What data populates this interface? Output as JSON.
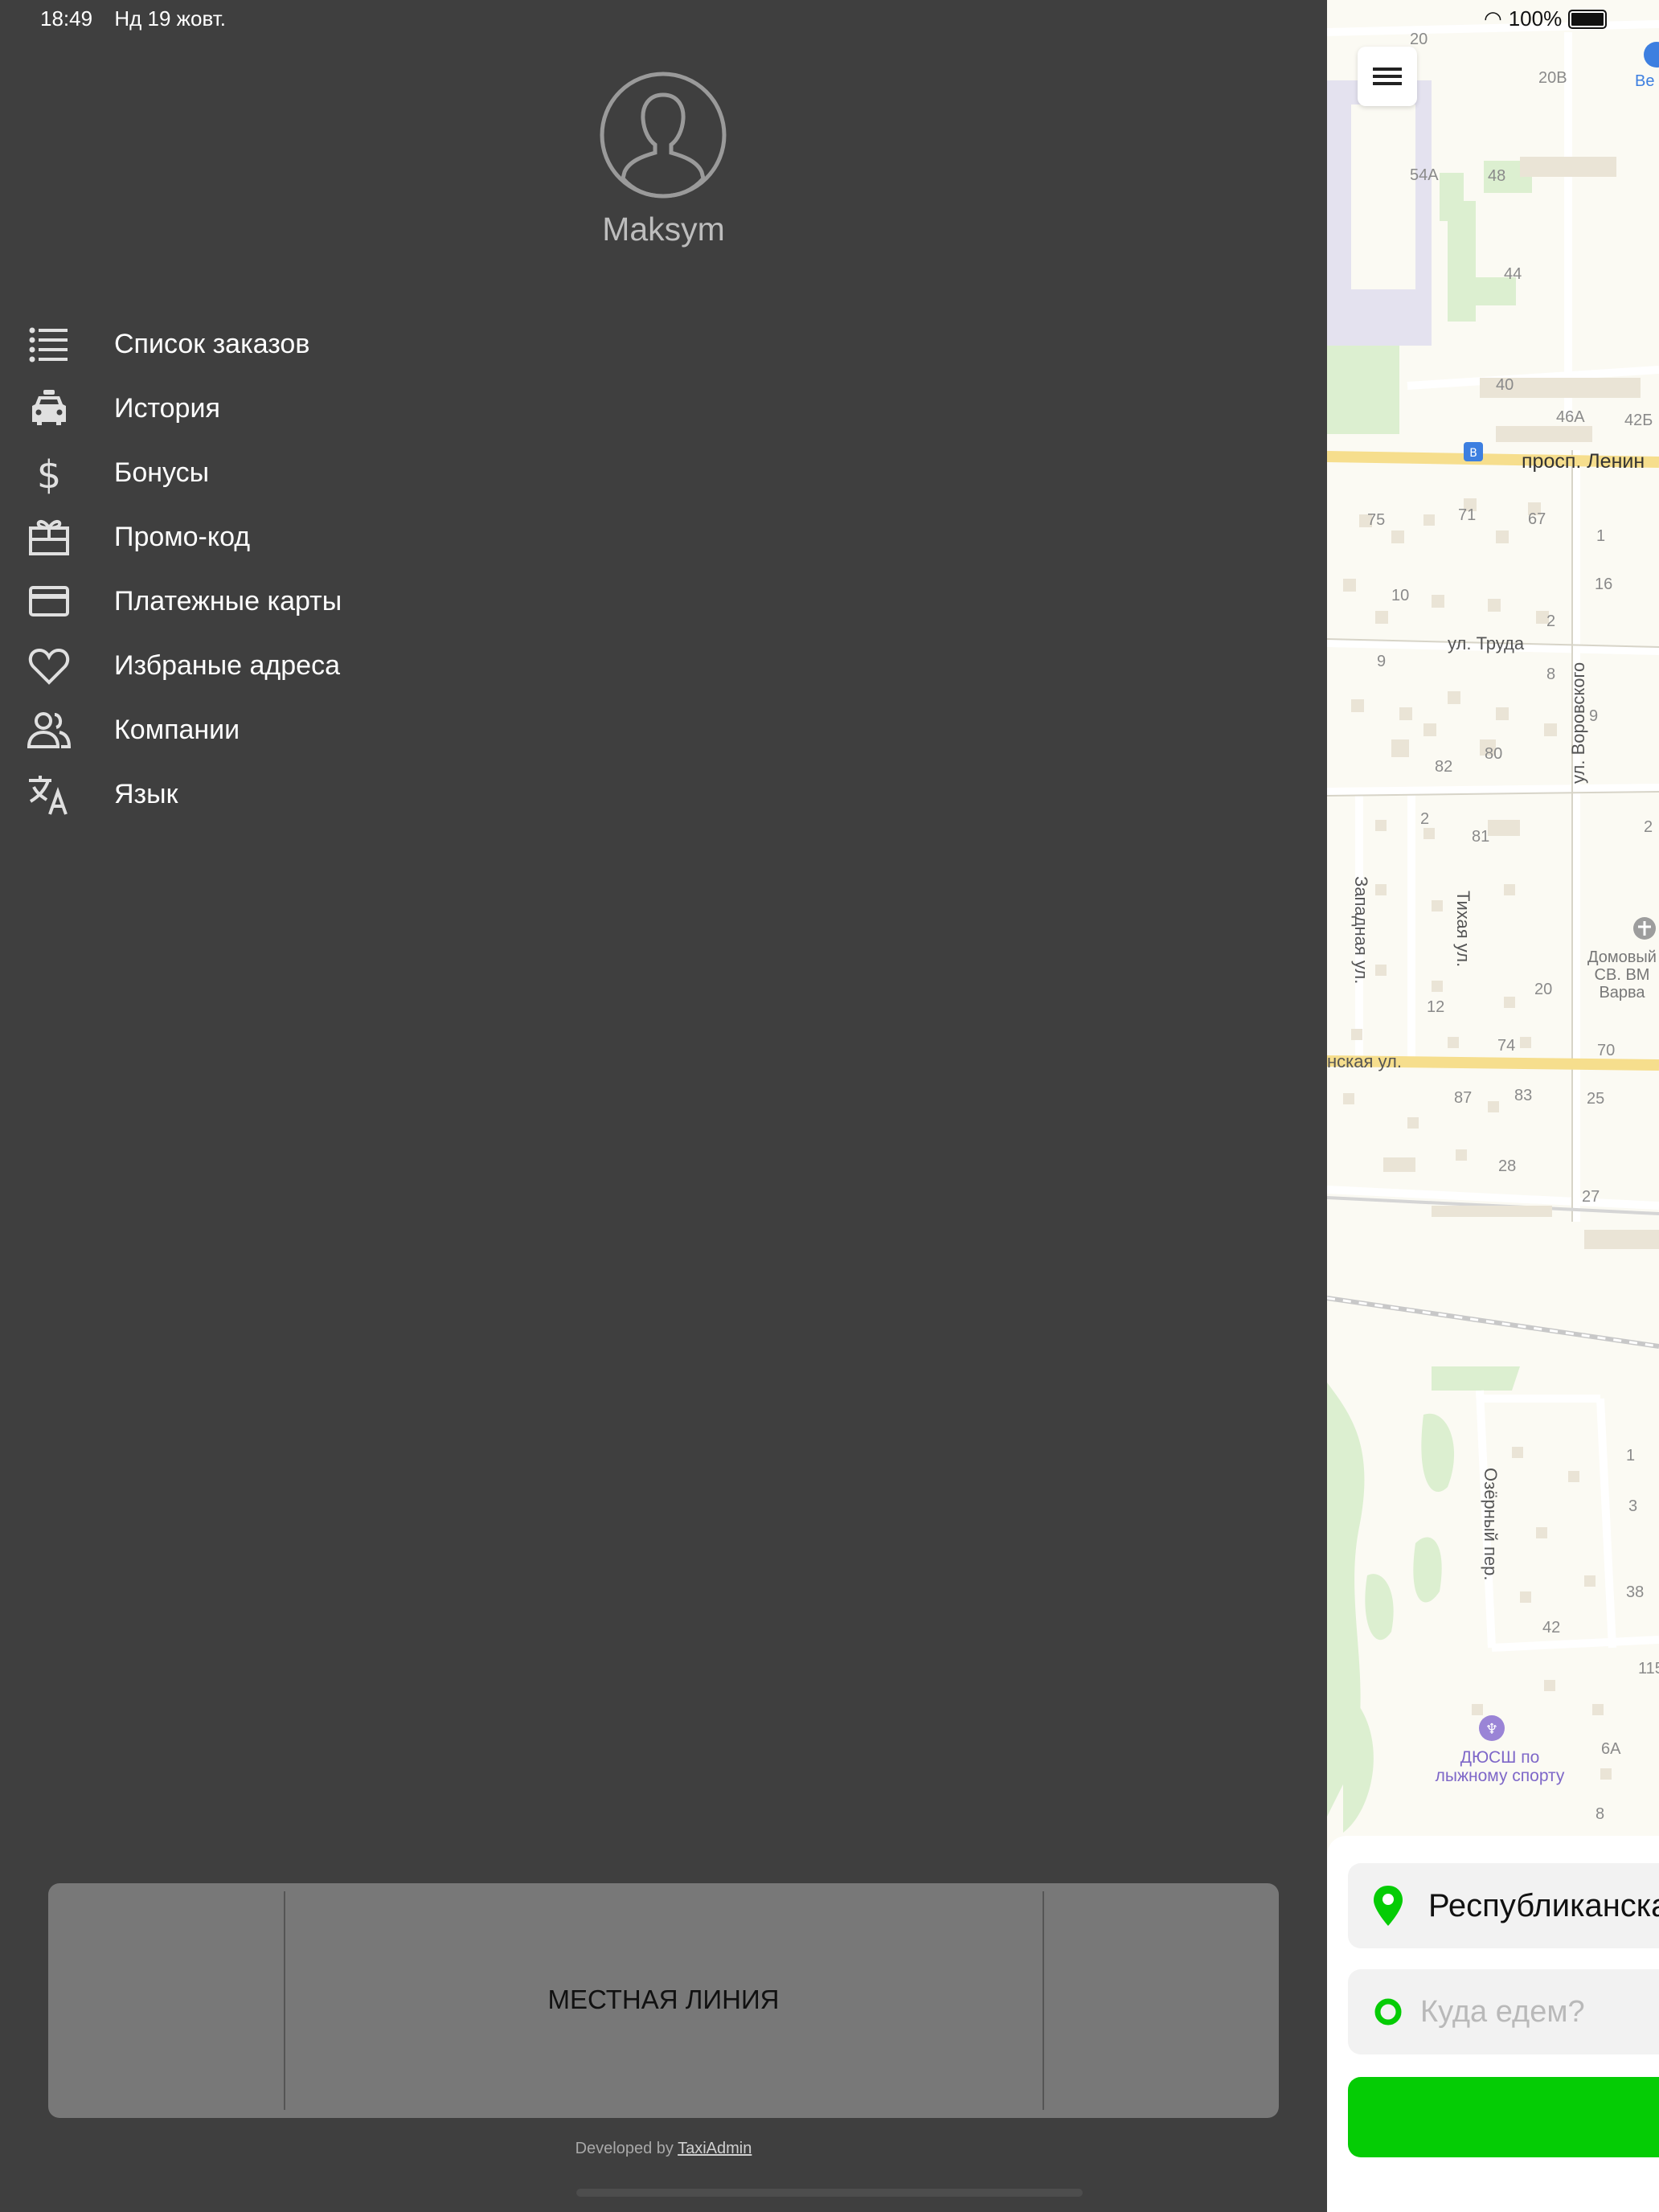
{
  "status_bar": {
    "time": "18:49",
    "date": "Нд 19 жовт.",
    "battery": "100%"
  },
  "profile": {
    "name": "Maksym"
  },
  "menu": {
    "items": [
      {
        "label": "Список заказов",
        "icon": "list-icon"
      },
      {
        "label": "История",
        "icon": "taxi-car-icon"
      },
      {
        "label": "Бонусы",
        "icon": "dollar-icon"
      },
      {
        "label": "Промо-код",
        "icon": "gift-icon"
      },
      {
        "label": "Платежные карты",
        "icon": "credit-card-icon"
      },
      {
        "label": "Избраные адреса",
        "icon": "heart-icon"
      },
      {
        "label": "Компании",
        "icon": "people-icon"
      },
      {
        "label": "Язык",
        "icon": "translate-icon"
      }
    ]
  },
  "phone_line": {
    "label": "МЕСТНАЯ ЛИНИЯ"
  },
  "credits": {
    "prefix": "Developed by ",
    "link": "TaxiAdmin"
  },
  "map": {
    "streets": {
      "prospekt": "просп. Ленин",
      "truda": "ул. Труда",
      "vorovskogo": "ул. Воровского",
      "zapadnaya": "Западная ул.",
      "tikhaya": "Тихая ул.",
      "respublikanskaya": "нская ул.",
      "ozerny": "Озёрный пер."
    },
    "pois": {
      "church": "Домовый СВ. ВМ Варва",
      "sport_school_1": "ДЮСШ по",
      "sport_school_2": "лыжному спорту",
      "top_poi": "Ве"
    },
    "house_numbers": [
      "20",
      "20В",
      "54А",
      "48",
      "44",
      "40",
      "46А",
      "42Б",
      "75",
      "71",
      "67",
      "1",
      "10",
      "16",
      "2",
      "9",
      "8",
      "9",
      "82",
      "80",
      "2",
      "81",
      "2",
      "12",
      "20",
      "74",
      "70",
      "87",
      "83",
      "25",
      "28",
      "27",
      "1",
      "3",
      "38",
      "42",
      "115",
      "6А",
      "8"
    ]
  },
  "route": {
    "from": "Республиканска",
    "to_placeholder": "Куда едем?"
  },
  "colors": {
    "accent": "#05cc05",
    "drawer_bg": "#3f3f3f",
    "panel": "#787878"
  }
}
